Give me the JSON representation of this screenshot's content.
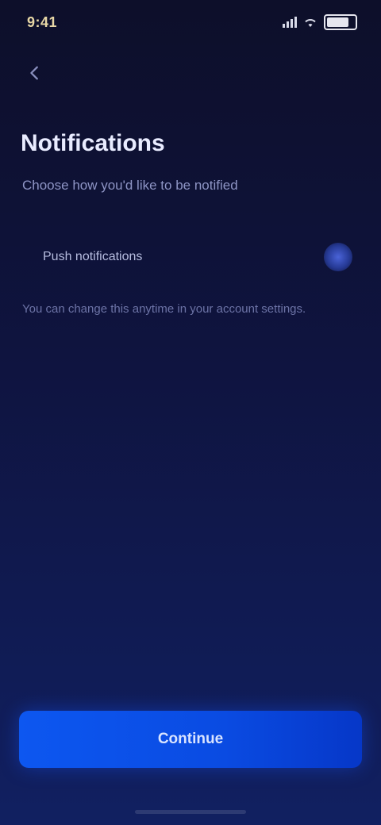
{
  "status_bar": {
    "time": "9:41",
    "battery_level": 0.7
  },
  "header": {
    "title": "Notifications",
    "subtitle": "Choose how you'd like to be notified"
  },
  "setting": {
    "label": "Push notifications",
    "enabled": true
  },
  "note": "You can change this anytime in your account settings.",
  "primary_button": {
    "label": "Continue"
  },
  "colors": {
    "background_top": "#0d0f2a",
    "background_bottom": "#112061",
    "accent": "#0d57f0"
  }
}
